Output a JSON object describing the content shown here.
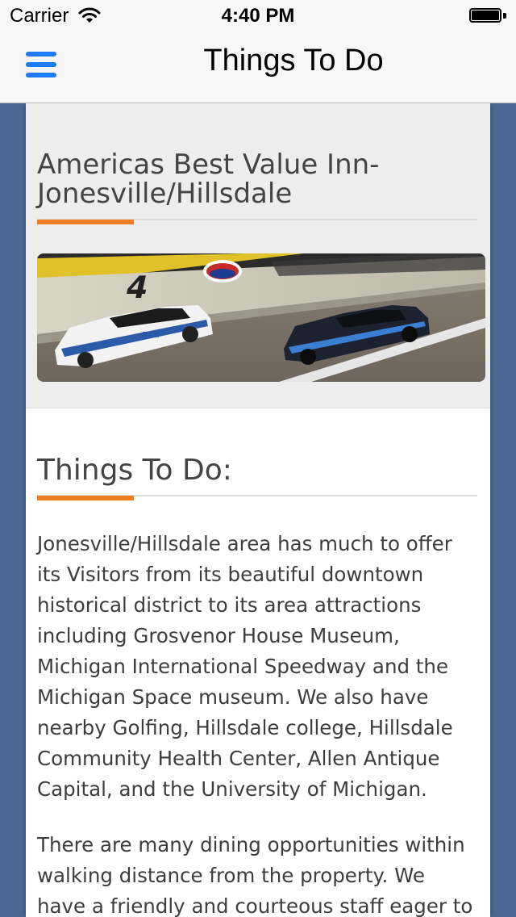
{
  "status_bar": {
    "carrier": "Carrier",
    "time": "4:40 PM"
  },
  "nav": {
    "title": "Things To Do",
    "menu_icon": "hamburger-menu-icon",
    "accent_color": "#1e7cf2"
  },
  "hero": {
    "hotel_name": "Americas Best Value Inn-Jonesville/Hillsdale",
    "image": "race-cars-on-track-photo"
  },
  "section": {
    "title": "Things To Do:",
    "paragraphs": [
      "Jonesville/Hillsdale area has much to offer its Visitors from its beautiful downtown historical district to its area attractions including Grosvenor House Museum, Michigan International Speedway and the Michigan Space museum. We also have nearby Golfing, Hillsdale college, Hillsdale Community Health Center, Allen Antique Capital, and the University of Michigan.",
      "There are many dining opportunities within walking distance from the property. We have a friendly and courteous staff eager to make"
    ]
  },
  "colors": {
    "background": "#4b6894",
    "heading_rule": "#f07d1f"
  }
}
